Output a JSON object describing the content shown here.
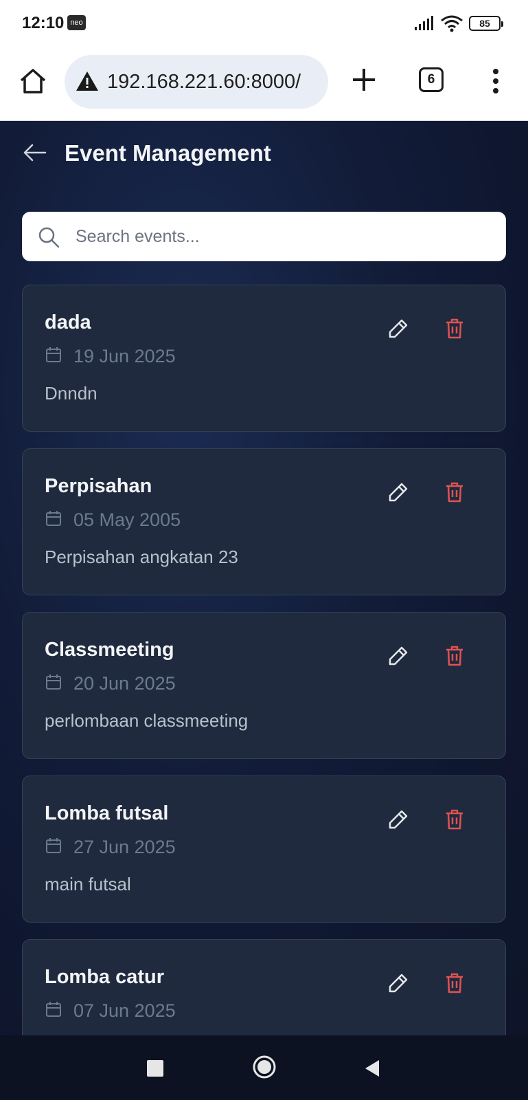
{
  "status_bar": {
    "time": "12:10",
    "carrier_badge": "neo",
    "battery": "85",
    "icons": [
      "signal-icon",
      "wifi-icon",
      "battery-icon"
    ]
  },
  "browser": {
    "url": "192.168.221.60:8000/",
    "tab_count": "6",
    "icons": [
      "home-icon",
      "warning-icon",
      "plus-icon",
      "tabs-icon",
      "menu-icon"
    ]
  },
  "app": {
    "title": "Event Management",
    "search": {
      "placeholder": "Search events...",
      "value": ""
    },
    "colors": {
      "background": "#121c38",
      "card": "#1f2a3e",
      "card_border": "#334155",
      "title": "#f3f4f6",
      "date": "#6b7a90",
      "description": "#b8c0cc",
      "delete": "#e05252",
      "edit": "#e5e7eb"
    },
    "events": [
      {
        "title": "dada",
        "date": "19 Jun 2025",
        "description": "Dnndn"
      },
      {
        "title": "Perpisahan",
        "date": "05 May 2005",
        "description": "Perpisahan angkatan 23"
      },
      {
        "title": "Classmeeting",
        "date": "20 Jun 2025",
        "description": "perlombaan classmeeting"
      },
      {
        "title": "Lomba futsal",
        "date": "27 Jun 2025",
        "description": "main futsal"
      },
      {
        "title": "Lomba catur",
        "date": "07 Jun 2025",
        "description": ""
      }
    ]
  },
  "nav_bar": {
    "icons": [
      "recents-icon",
      "home-circle-icon",
      "back-triangle-icon"
    ]
  }
}
